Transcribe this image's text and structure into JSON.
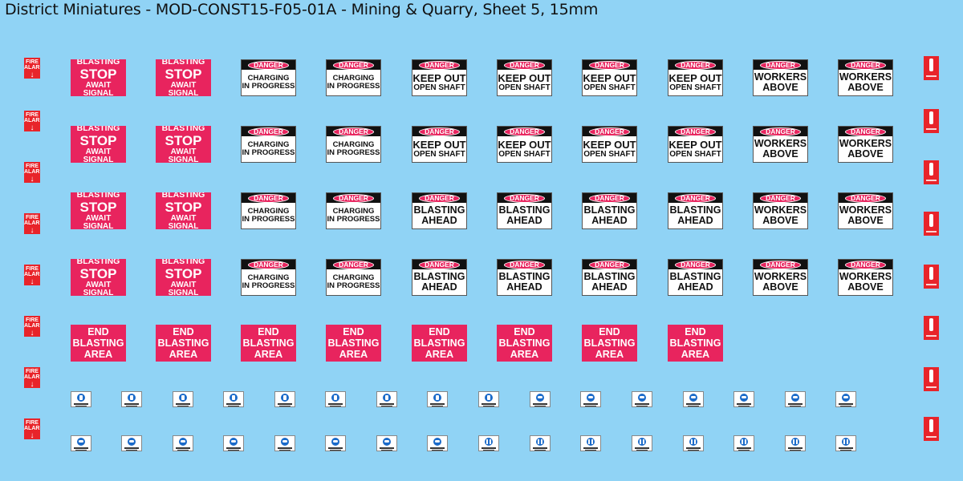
{
  "title": "District Miniatures - MOD-CONST15-F05-01A - Mining & Quarry, Sheet 5, 15mm",
  "colors": {
    "background": "#90d3f5",
    "signRed": "#e8245e",
    "fireRed": "#e8242a",
    "mandatoryBlue": "#1a6ac9"
  },
  "fireAlarm": {
    "line1": "FIRE",
    "line2": "ALARM",
    "arrow": "↓"
  },
  "blastingStop": [
    "BLASTING",
    "STOP",
    "AWAIT",
    "SIGNAL"
  ],
  "dangerHeader": "DANGER",
  "chargingInProgress": [
    "CHARGING",
    "IN PROGRESS"
  ],
  "keepOutOpenShaft": [
    "KEEP OUT",
    "OPEN SHAFT"
  ],
  "blastingAhead": [
    "BLASTING",
    "AHEAD"
  ],
  "workersAbove": [
    "WORKERS",
    "ABOVE"
  ],
  "endBlastingArea": [
    "END",
    "BLASTING",
    "AREA"
  ],
  "icons": {
    "fireExtinguisher": "fire-extinguisher-icon",
    "gloves": "safety-gloves-icon",
    "goggles": "safety-goggles-icon",
    "helmet": "hard-hat-icon",
    "shield": "face-shield-icon",
    "suit": "protective-clothing-icon"
  }
}
